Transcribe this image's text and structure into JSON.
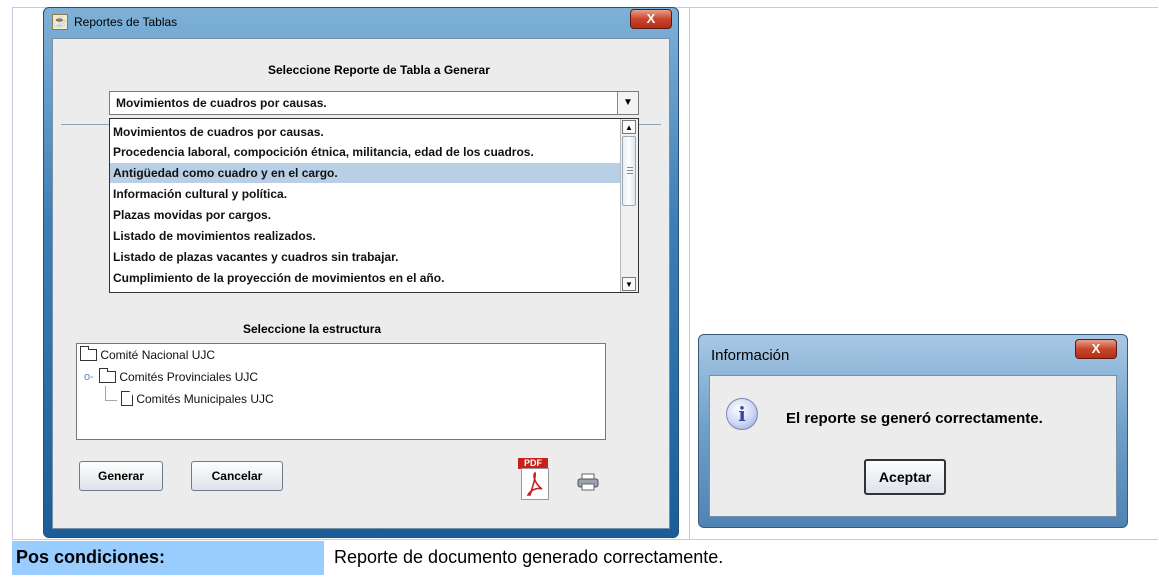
{
  "main_window": {
    "title": "Reportes de Tablas",
    "close_glyph": "X",
    "report_heading": "Seleccione Reporte de Tabla a Generar",
    "combo_value": "Movimientos de cuadros por causas.",
    "report_options": [
      "Movimientos de cuadros por causas.",
      "Procedencia laboral, compocición étnica, militancia, edad de los cuadros.",
      "Antigüedad como cuadro y en el cargo.",
      "Información cultural y política.",
      "Plazas movidas por cargos.",
      "Listado de movimientos realizados.",
      "Listado de plazas vacantes y cuadros sin trabajar.",
      "Cumplimiento de la proyección de movimientos en el año."
    ],
    "selected_option_index": 2,
    "structure_heading": "Seleccione la estructura",
    "tree": {
      "root": "Comité Nacional UJC",
      "child": "Comités Provinciales UJC",
      "grandchild": "Comités Municipales UJC"
    },
    "generate_label": "Generar",
    "cancel_label": "Cancelar",
    "pdf_tag": "PDF",
    "icons": [
      "java-icon",
      "pdf-icon",
      "printer-icon"
    ]
  },
  "info_dialog": {
    "title": "Información",
    "close_glyph": "X",
    "message": "El reporte se generó correctamente.",
    "info_glyph": "i",
    "accept_label": "Aceptar"
  },
  "postconditions": {
    "label": "Pos condiciones:",
    "value": "Reporte de documento generado correctamente."
  }
}
